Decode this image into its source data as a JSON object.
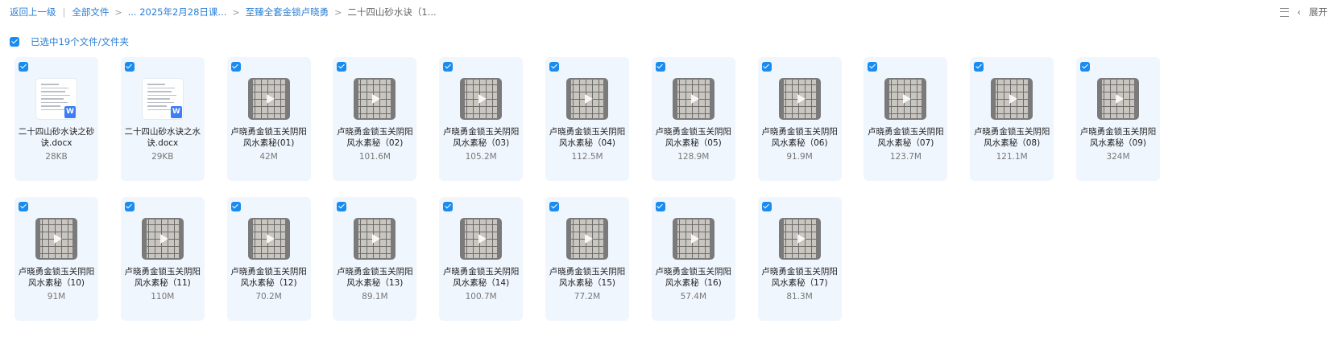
{
  "breadcrumb": {
    "back": "返回上一级",
    "all_files": "全部文件",
    "path2": "... 2025年2月28日课...",
    "path3": "至臻全套金锁卢晓勇",
    "current": "二十四山砂水诀（1..."
  },
  "toolbar": {
    "expand": "展开"
  },
  "selection": {
    "text": "已选中19个文件/文件夹"
  },
  "files": [
    {
      "name": "二十四山砂水诀之砂诀.docx",
      "size": "28KB",
      "type": "doc"
    },
    {
      "name": "二十四山砂水诀之水诀.docx",
      "size": "29KB",
      "type": "doc"
    },
    {
      "name": "卢晓勇金锁玉关阴阳风水素秘(01)",
      "size": "42M",
      "type": "video"
    },
    {
      "name": "卢晓勇金锁玉关阴阳风水素秘（02)",
      "size": "101.6M",
      "type": "video"
    },
    {
      "name": "卢晓勇金锁玉关阴阳风水素秘（03)",
      "size": "105.2M",
      "type": "video"
    },
    {
      "name": "卢晓勇金锁玉关阴阳风水素秘（04)",
      "size": "112.5M",
      "type": "video"
    },
    {
      "name": "卢晓勇金锁玉关阴阳风水素秘（05)",
      "size": "128.9M",
      "type": "video"
    },
    {
      "name": "卢晓勇金锁玉关阴阳风水素秘（06)",
      "size": "91.9M",
      "type": "video"
    },
    {
      "name": "卢晓勇金锁玉关阴阳风水素秘（07)",
      "size": "123.7M",
      "type": "video"
    },
    {
      "name": "卢晓勇金锁玉关阴阳风水素秘（08)",
      "size": "121.1M",
      "type": "video"
    },
    {
      "name": "卢晓勇金锁玉关阴阳风水素秘（09)",
      "size": "324M",
      "type": "video"
    },
    {
      "name": "卢晓勇金锁玉关阴阳风水素秘（10)",
      "size": "91M",
      "type": "video"
    },
    {
      "name": "卢晓勇金锁玉关阴阳风水素秘（11)",
      "size": "110M",
      "type": "video"
    },
    {
      "name": "卢晓勇金锁玉关阴阳风水素秘（12)",
      "size": "70.2M",
      "type": "video"
    },
    {
      "name": "卢晓勇金锁玉关阴阳风水素秘（13)",
      "size": "89.1M",
      "type": "video"
    },
    {
      "name": "卢晓勇金锁玉关阴阳风水素秘（14)",
      "size": "100.7M",
      "type": "video"
    },
    {
      "name": "卢晓勇金锁玉关阴阳风水素秘（15)",
      "size": "77.2M",
      "type": "video"
    },
    {
      "name": "卢晓勇金锁玉关阴阳风水素秘（16)",
      "size": "57.4M",
      "type": "video"
    },
    {
      "name": "卢晓勇金锁玉关阴阳风水素秘（17)",
      "size": "81.3M",
      "type": "video"
    }
  ],
  "colors": {
    "accent": "#1a8cf0",
    "link": "#2a7fd4",
    "card_bg": "#f0f6fd"
  }
}
